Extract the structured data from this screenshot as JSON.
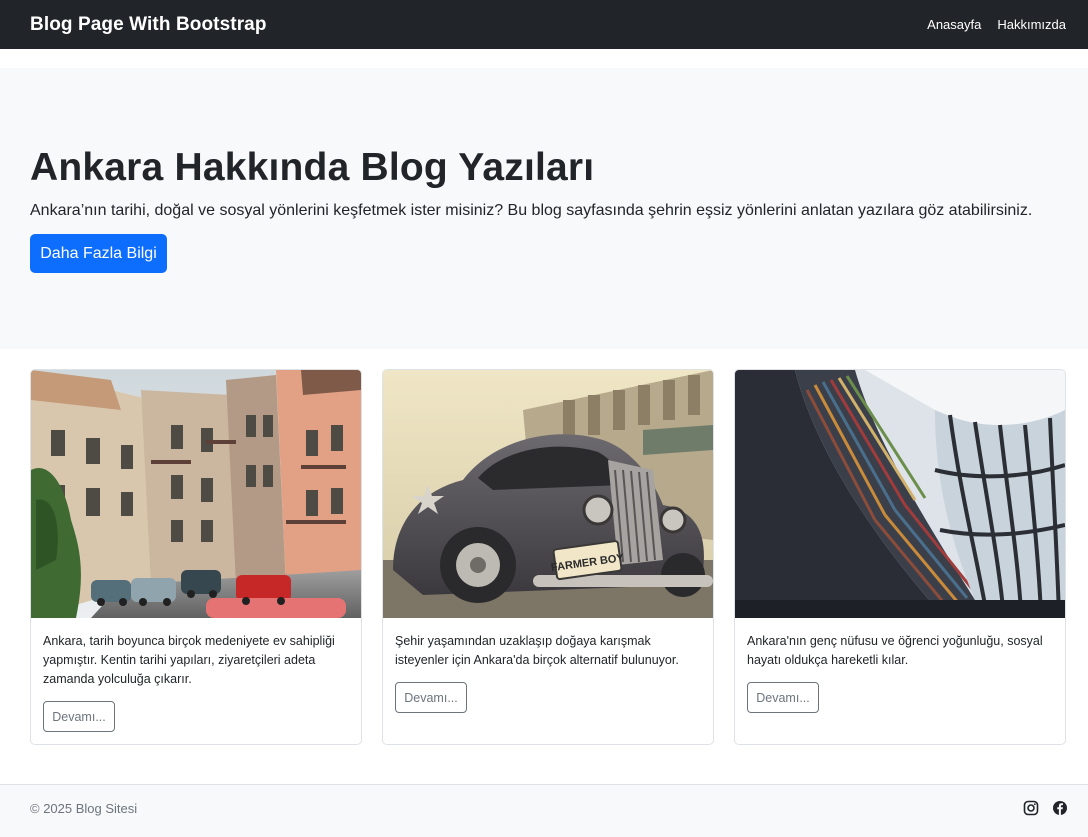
{
  "navbar": {
    "brand": "Blog Page With Bootstrap",
    "links": [
      "Anasayfa",
      "Hakkımızda"
    ]
  },
  "hero": {
    "title": "Ankara Hakkında Blog Yazıları",
    "text": "Ankara’nın tarihi, doğal ve sosyal yönlerini keşfetmek ister misiniz? Bu blog sayfasında şehrin eşsiz yönlerini anlatan yazılara göz atabilirsiniz.",
    "button": "Daha Fazla Bilgi"
  },
  "cards": [
    {
      "text": "Ankara, tarih boyunca birçok medeniyete ev sahipliği yapmıştır. Kentin tarihi yapıları, ziyaretçileri adeta zamanda yolculuğa çıkarır.",
      "button": "Devamı..."
    },
    {
      "text": "Şehir yaşamından uzaklaşıp doğaya karışmak isteyenler için Ankara'da birçok alternatif bulunuyor.",
      "button": "Devamı...",
      "plate": "FARMER BOY"
    },
    {
      "text": "Ankara'nın genç nüfusu ve öğrenci yoğunluğu, sosyal hayatı oldukça hareketli kılar.",
      "button": "Devamı..."
    }
  ],
  "footer": {
    "copyright": "© 2025 Blog Sitesi",
    "icons": [
      "instagram-icon",
      "facebook-icon"
    ]
  },
  "colors": {
    "navbar": "#212529",
    "primary": "#0d6efd",
    "light": "#f8f9fa",
    "secondary": "#6c757d"
  }
}
